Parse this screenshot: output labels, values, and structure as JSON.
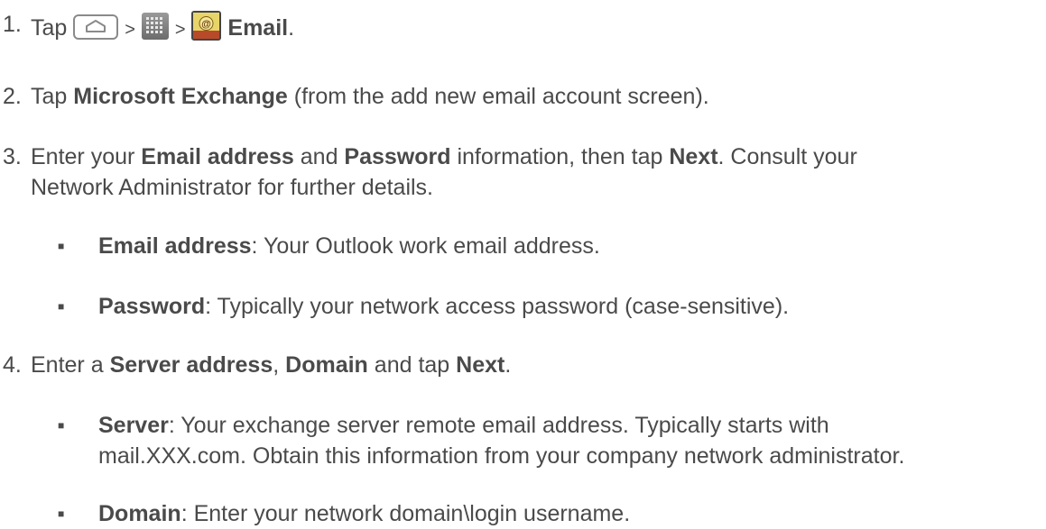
{
  "steps": [
    {
      "num": "1.",
      "tap": "Tap",
      "sep1": ">",
      "sep2": ">",
      "email_label": "Email",
      "period": ".",
      "icons": [
        "home-icon",
        "apps-icon",
        "email-app-icon"
      ]
    },
    {
      "num": "2.",
      "pre": "Tap ",
      "bold": "Microsoft Exchange",
      "post": " (from the add new email account screen)."
    },
    {
      "num": "3.",
      "pre": "Enter your ",
      "bold1": "Email address",
      "mid1": " and ",
      "bold2": "Password",
      "mid2": " information, then tap ",
      "bold3": "Next",
      "post": ". Consult your",
      "line2": "Network Administrator for further details.",
      "bullets": [
        {
          "bold": "Email address",
          "text": ": Your Outlook work email address."
        },
        {
          "bold": "Password",
          "text": ": Typically your network access password (case-sensitive)."
        }
      ]
    },
    {
      "num": "4.",
      "pre": "Enter a ",
      "bold1": "Server address",
      "mid1": ", ",
      "bold2": "Domain",
      "mid2": " and tap ",
      "bold3": "Next",
      "post": ".",
      "bullets": [
        {
          "bold": "Server",
          "text": ": Your exchange server remote email address. Typically starts with",
          "line2": "mail.XXX.com. Obtain this information from your company network administrator."
        },
        {
          "bold": "Domain",
          "text": ": Enter your network domain\\login username."
        }
      ]
    }
  ],
  "bullet_glyph": "■"
}
